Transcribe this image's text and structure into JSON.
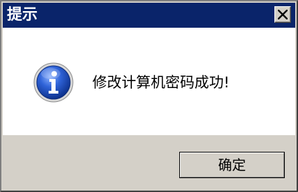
{
  "dialog": {
    "title": "提示",
    "message": "修改计算机密码成功!",
    "ok_label": "确定",
    "close_icon": "close-icon",
    "message_icon": "info-icon"
  },
  "colors": {
    "titlebar": "#0a246a",
    "title_text": "#ffffff",
    "content_bg": "#ffffff",
    "chrome_bg": "#d4d0c8",
    "icon_blue": "#1f4fb5"
  }
}
